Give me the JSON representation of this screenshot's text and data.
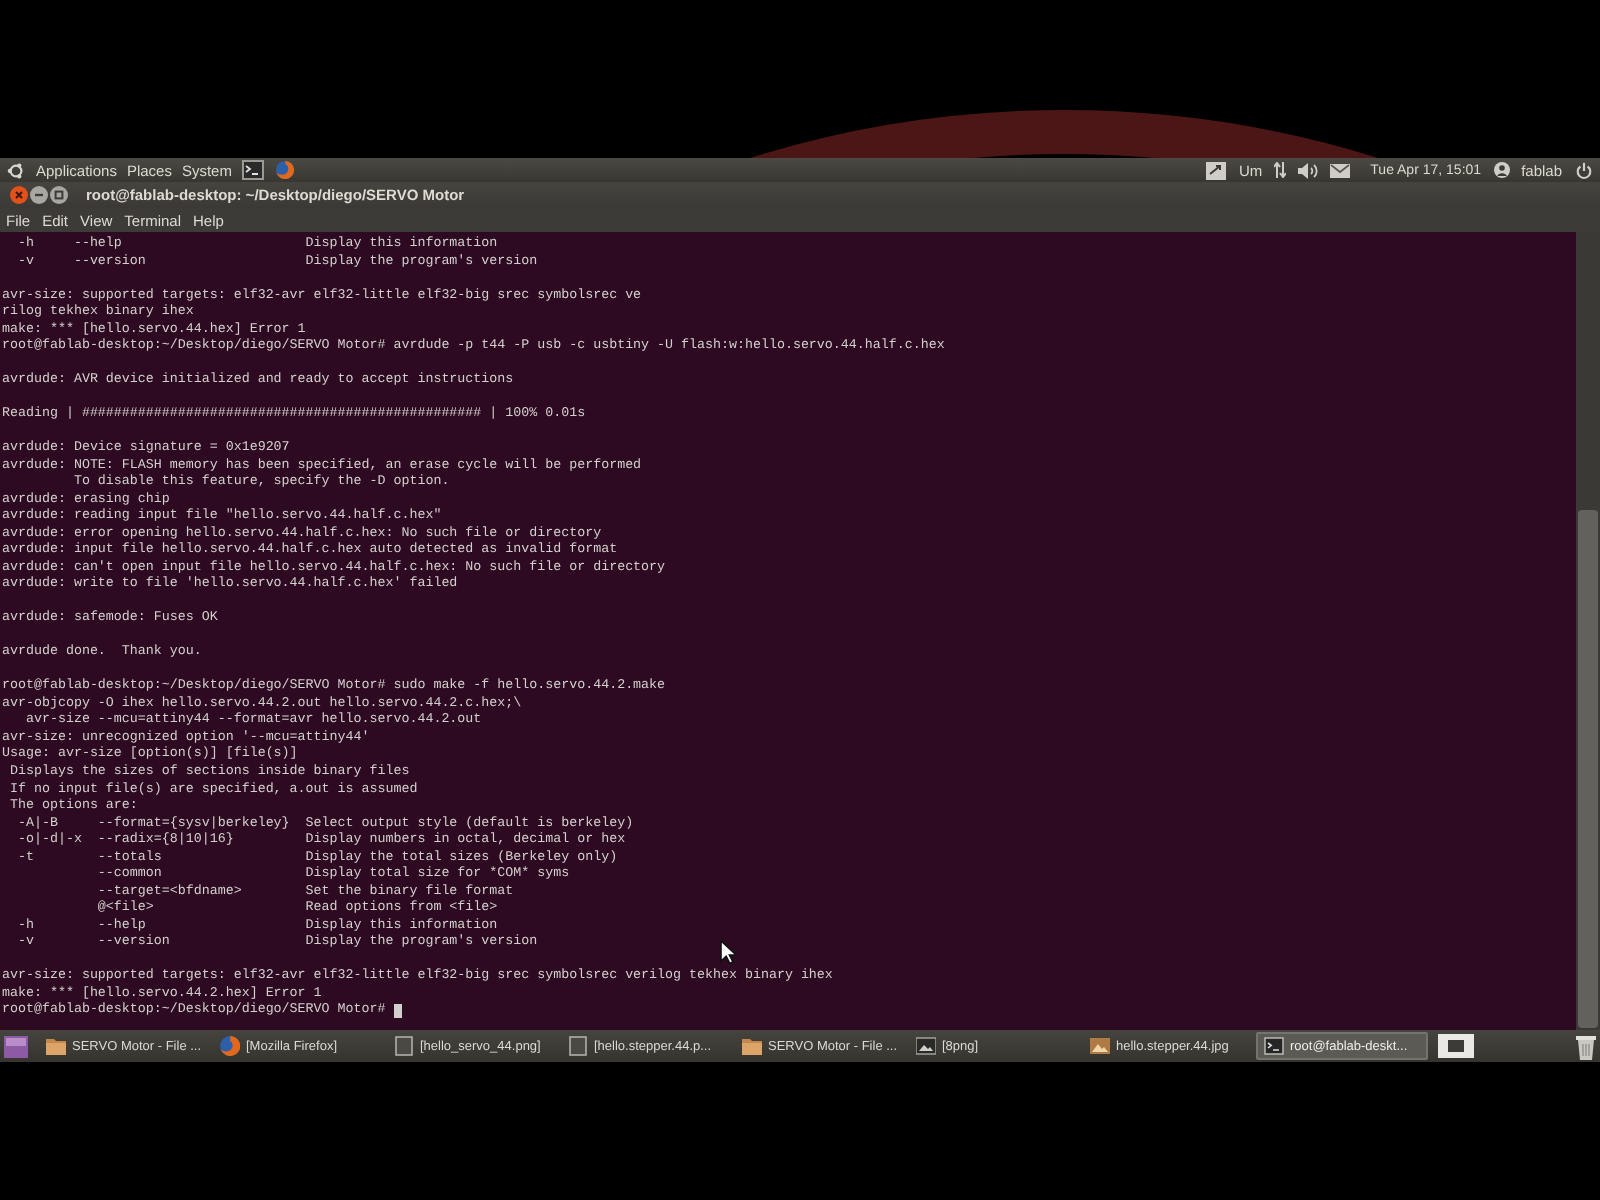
{
  "top_panel": {
    "menus": [
      "Applications",
      "Places",
      "System"
    ],
    "indicator": "Um",
    "clock": "Tue Apr 17, 15:01",
    "user": "fablab"
  },
  "window": {
    "title": "root@fablab-desktop: ~/Desktop/diego/SERVO Motor",
    "menu": [
      "File",
      "Edit",
      "View",
      "Terminal",
      "Help"
    ]
  },
  "terminal": {
    "blocks": [
      {
        "lines": [
          "  -h     --help                       Display this information",
          "  -v     --version                    Display the program's version"
        ]
      },
      {
        "lines": [
          "avr-size: supported targets: elf32-avr elf32-little elf32-big srec symbolsrec ve",
          "rilog tekhex binary ihex",
          "make: *** [hello.servo.44.hex] Error 1",
          "root@fablab-desktop:~/Desktop/diego/SERVO Motor# avrdude -p t44 -P usb -c usbtiny -U flash:w:hello.servo.44.half.c.hex"
        ]
      },
      {
        "lines": [
          "avrdude: AVR device initialized and ready to accept instructions"
        ]
      },
      {
        "lines": [
          "Reading | ################################################## | 100% 0.01s"
        ]
      },
      {
        "lines": [
          "avrdude: Device signature = 0x1e9207",
          "avrdude: NOTE: FLASH memory has been specified, an erase cycle will be performed",
          "         To disable this feature, specify the -D option.",
          "avrdude: erasing chip",
          "avrdude: reading input file \"hello.servo.44.half.c.hex\"",
          "avrdude: error opening hello.servo.44.half.c.hex: No such file or directory",
          "avrdude: input file hello.servo.44.half.c.hex auto detected as invalid format",
          "avrdude: can't open input file hello.servo.44.half.c.hex: No such file or directory",
          "avrdude: write to file 'hello.servo.44.half.c.hex' failed"
        ]
      },
      {
        "lines": [
          "avrdude: safemode: Fuses OK"
        ]
      },
      {
        "lines": [
          "avrdude done.  Thank you."
        ]
      },
      {
        "lines": [
          "root@fablab-desktop:~/Desktop/diego/SERVO Motor# sudo make -f hello.servo.44.2.make",
          "avr-objcopy -O ihex hello.servo.44.2.out hello.servo.44.2.c.hex;\\",
          "   avr-size --mcu=attiny44 --format=avr hello.servo.44.2.out",
          "avr-size: unrecognized option '--mcu=attiny44'",
          "Usage: avr-size [option(s)] [file(s)]",
          " Displays the sizes of sections inside binary files",
          " If no input file(s) are specified, a.out is assumed",
          " The options are:",
          "  -A|-B     --format={sysv|berkeley}  Select output style (default is berkeley)",
          "  -o|-d|-x  --radix={8|10|16}         Display numbers in octal, decimal or hex",
          "  -t        --totals                  Display the total sizes (Berkeley only)",
          "            --common                  Display total size for *COM* syms",
          "            --target=<bfdname>        Set the binary file format",
          "            @<file>                   Read options from <file>",
          "  -h        --help                    Display this information",
          "  -v        --version                 Display the program's version"
        ]
      },
      {
        "lines": [
          "avr-size: supported targets: elf32-avr elf32-little elf32-big srec symbolsrec verilog tekhex binary ihex",
          "make: *** [hello.servo.44.2.hex] Error 1",
          "root@fablab-desktop:~/Desktop/diego/SERVO Motor#"
        ]
      }
    ],
    "cursor": true
  },
  "taskbar": {
    "items": [
      {
        "label": "SERVO Motor - File ...",
        "kind": "folder",
        "selected": false
      },
      {
        "label": "[Mozilla Firefox]",
        "kind": "browser",
        "selected": false
      },
      {
        "label": "[hello_servo_44.png]",
        "kind": "generic",
        "selected": false
      },
      {
        "label": "[hello.stepper.44.p...",
        "kind": "generic",
        "selected": false
      },
      {
        "label": "SERVO Motor - File ...",
        "kind": "folder",
        "selected": false
      },
      {
        "label": "[8png]",
        "kind": "viewer",
        "selected": false
      },
      {
        "label": "hello.stepper.44.jpg",
        "kind": "image",
        "selected": false
      },
      {
        "label": "root@fablab-deskt...",
        "kind": "terminal",
        "selected": true
      }
    ]
  }
}
